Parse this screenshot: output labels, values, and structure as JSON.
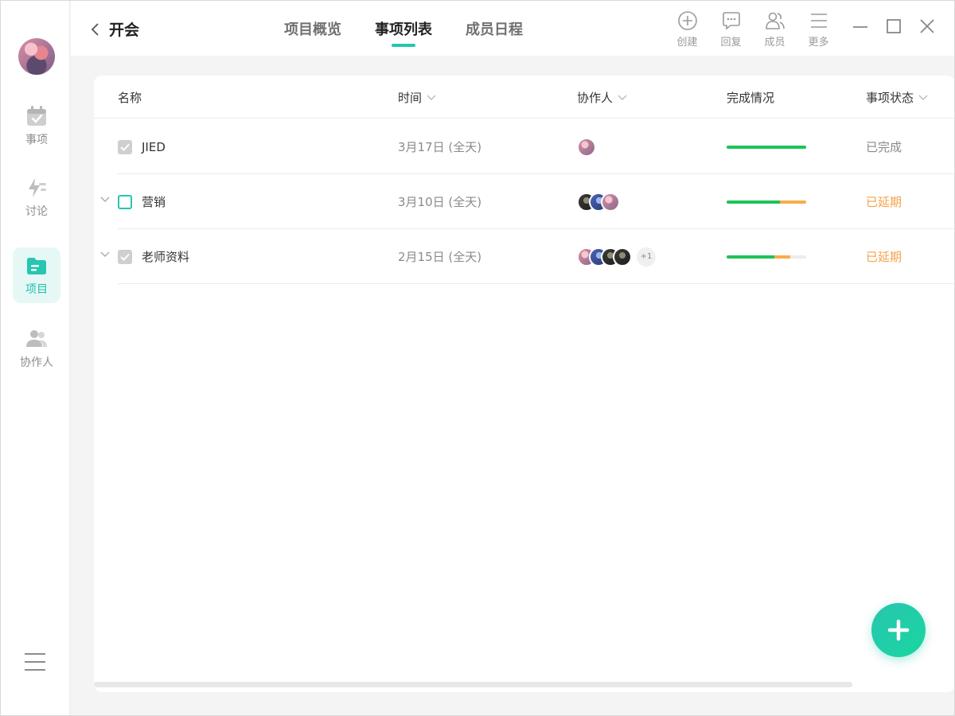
{
  "header": {
    "title": "开会",
    "tabs": [
      {
        "label": "项目概览",
        "active": false
      },
      {
        "label": "事项列表",
        "active": true
      },
      {
        "label": "成员日程",
        "active": false
      }
    ],
    "tools": [
      {
        "label": "创建",
        "icon": "plus-circle-icon"
      },
      {
        "label": "回复",
        "icon": "chat-bubble-icon"
      },
      {
        "label": "成员",
        "icon": "members-icon"
      },
      {
        "label": "更多",
        "icon": "menu-lines-icon"
      }
    ]
  },
  "sidebar": {
    "items": [
      {
        "label": "事项",
        "icon": "calendar-check-icon",
        "active": false
      },
      {
        "label": "讨论",
        "icon": "lightning-icon",
        "active": false
      },
      {
        "label": "项目",
        "icon": "folder-icon",
        "active": true
      },
      {
        "label": "协作人",
        "icon": "people-icon",
        "active": false
      }
    ]
  },
  "table": {
    "columns": [
      "名称",
      "时间",
      "协作人",
      "完成情况",
      "事项状态"
    ],
    "rows": [
      {
        "name": "JIED",
        "time": "3月17日 (全天)",
        "status": "已完成",
        "status_color": "#8a8a8a",
        "checked": true,
        "expandable": false,
        "avatars": [
          "pink"
        ],
        "extra": "",
        "progress_done": 1.0,
        "progress_late": 0.0
      },
      {
        "name": "营销",
        "time": "3月10日 (全天)",
        "status": "已延期",
        "status_color": "#f5a04a",
        "checked": false,
        "expandable": true,
        "avatars": [
          "dark",
          "blue",
          "pink"
        ],
        "extra": "",
        "progress_done": 0.67,
        "progress_late": 0.33
      },
      {
        "name": "老师资料",
        "time": "2月15日 (全天)",
        "status": "已延期",
        "status_color": "#f5a04a",
        "checked": true,
        "expandable": true,
        "avatars": [
          "pink",
          "blue",
          "dark",
          "dark"
        ],
        "extra": "+1",
        "progress_done": 0.6,
        "progress_late": 0.2
      }
    ]
  },
  "colors": {
    "accent": "#26c6b0",
    "progress_green": "#1dc35a",
    "progress_orange": "#f7ad4a"
  }
}
